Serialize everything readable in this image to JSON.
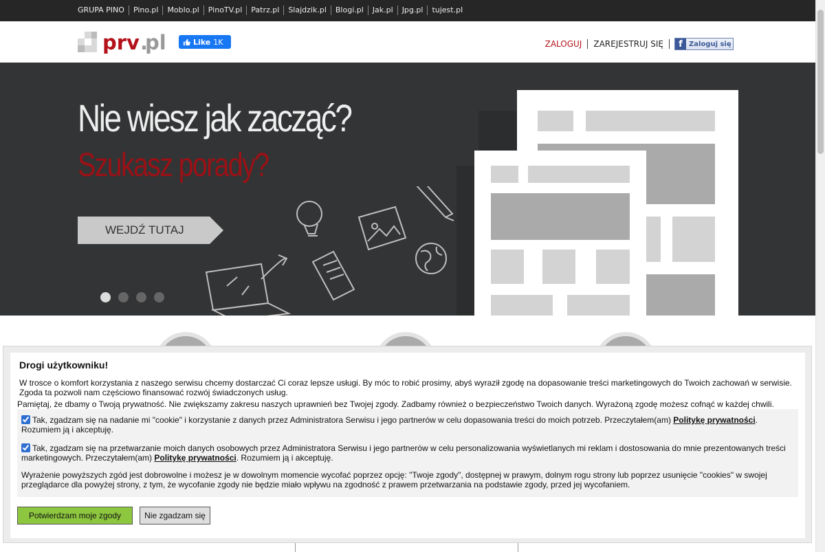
{
  "topbar": {
    "brand": "GRUPA PINO",
    "links": [
      "Pino.pl",
      "Moblo.pl",
      "PinoTV.pl",
      "Patrz.pl",
      "Slajdzik.pl",
      "Blogi.pl",
      "Jak.pl",
      "Jpg.pl",
      "tujest.pl"
    ]
  },
  "header": {
    "logo_text_main": "prv",
    "logo_text_dot": ".",
    "logo_text_tld": "pl",
    "fb_like_label": "Like",
    "fb_like_count": "1K",
    "login": "ZALOGUJ",
    "register": "ZAREJESTRUJ SIĘ",
    "fb_login": "Zaloguj się"
  },
  "hero": {
    "headline": "Nie wiesz jak zacząć?",
    "subheadline": "Szukasz porady?",
    "cta": "WEJDŹ TUTAJ",
    "slides": 4,
    "active_slide": 1
  },
  "below": {
    "fragment_left": "...",
    "fragment_mid": "...",
    "fragment_bottom": "..."
  },
  "consent": {
    "title": "Drogi użytkowniku!",
    "intro_line1": "W trosce o komfort korzystania z naszego serwisu chcemy dostarczać Ci coraz lepsze usługi. By móc to robić prosimy, abyś wyraził zgodę na dopasowanie treści marketingowych do Twoich zachowań w serwisie.",
    "intro_line2": "Zgoda ta pozwoli nam częściowo finansować rozwój świadczonych usług.",
    "privacy_note": "Pamiętaj, że dbamy o Twoją prywatność. Nie zwiększamy zakresu naszych uprawnień bez Twojej zgody. Zadbamy również o bezpieczeństwo Twoich danych. Wyrażoną zgodę możesz cofnąć w każdej chwili.",
    "option1_pre": "Tak, zgadzam się na nadanie mi \"cookie\" i korzystanie z danych przez Administratora Serwisu i jego partnerów w celu dopasowania treści do moich potrzeb. Przeczytałem(am) ",
    "option1_link": "Politykę prywatności",
    "option1_post": ". Rozumiem ją i akceptuję.",
    "option1_checked": true,
    "option2_pre": "Tak, zgadzam się na przetwarzanie moich danych osobowych przez Administratora Serwisu i jego partnerów w celu personalizowania wyświetlanych mi reklam i dostosowania do mnie prezentowanych treści marketingowych. Przeczytałem(am) ",
    "option2_link": "Politykę prywatności",
    "option2_post": ". Rozumiem ją i akceptuję.",
    "option2_checked": true,
    "disclaimer": "Wyrażenie powyższych zgód jest dobrowolne i możesz je w dowolnym momencie wycofać poprzez opcję: \"Twoje zgody\", dostępnej w prawym, dolnym rogu strony lub poprzez usunięcie \"cookies\" w swojej przeglądarce dla powyżej strony, z tym, że wycofanie zgody nie będzie miało wpływu na zgodność z prawem przetwarzania na podstawie zgody, przed jej wycofaniem.",
    "accept_button": "Potwierdzam moje zgody",
    "reject_button": "Nie zgadzam się"
  },
  "colors": {
    "topbar_bg": "#262626",
    "hero_bg": "#323435",
    "brand_red": "#b3121a",
    "accept_green": "#8dc63f"
  }
}
